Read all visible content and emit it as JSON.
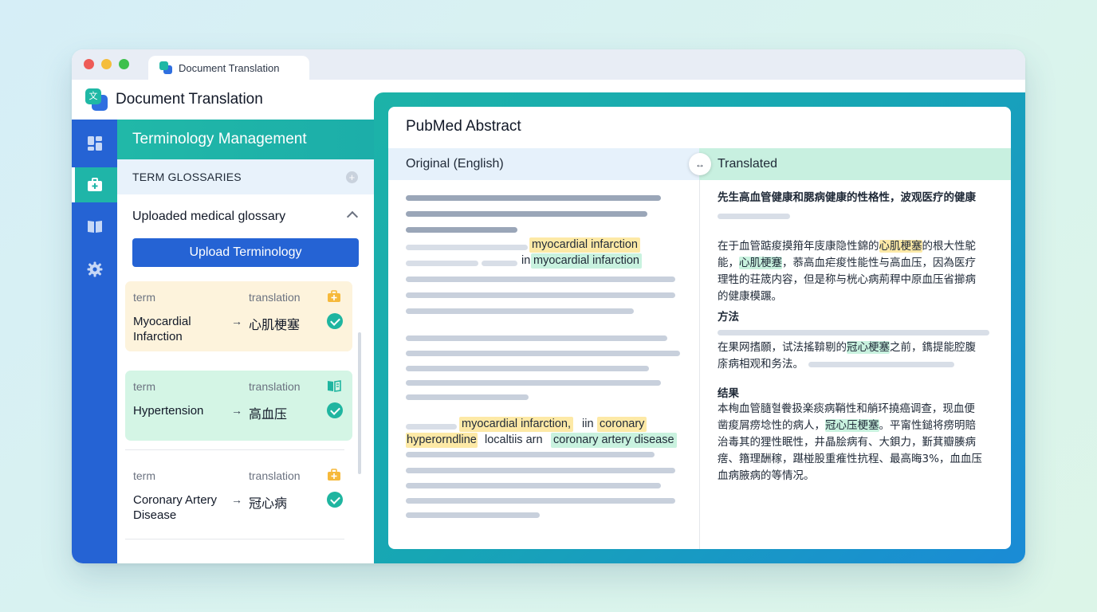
{
  "tab": {
    "title": "Document Translation"
  },
  "app": {
    "title": "Document Translation",
    "logo_glyph": "文"
  },
  "sidebar": {
    "items": [
      {
        "icon": "dashboard-icon",
        "active": false
      },
      {
        "icon": "medical-kit-icon",
        "active": true
      },
      {
        "icon": "book-icon",
        "active": false
      },
      {
        "icon": "gear-icon",
        "active": false
      }
    ],
    "bottom_icon": "logout-icon"
  },
  "panel": {
    "title": "Terminology Management",
    "section_label": "TERM GLOSSARIES",
    "glossary_name": "Uploaded medical glossary",
    "upload_label": "Upload Terminology",
    "terms": [
      {
        "term_label": "term",
        "translation_label": "translation",
        "term": "Myocardial Infarction",
        "translation": "心肌梗塞",
        "icon": "medical-kit-icon",
        "bg": "#fdf3dc"
      },
      {
        "term_label": "term",
        "translation_label": "translation",
        "term": "Hypertension",
        "translation": "高血压",
        "icon": "book-icon",
        "bg": "#d4f5e5"
      },
      {
        "term_label": "term",
        "translation_label": "translation",
        "term": "Coronary Artery Disease",
        "translation": "冠心病",
        "icon": "medical-kit-icon",
        "bg": "#ffffff"
      }
    ],
    "arrow": "→"
  },
  "doc": {
    "title": "PubMed Abstract",
    "original_label": "Original (English)",
    "translated_label": "Translated",
    "swap_glyph": "↔",
    "original": {
      "hl1": "myocardial infarction",
      "in_word": "in",
      "hl2": "myocardial infarction",
      "hl3": "myocardial infarction,",
      "iin": "iin",
      "hl4": "coronary",
      "hl5": "hyperorndline",
      "mid": "localtiis arn",
      "hl6": "coronary artery disease"
    },
    "translated": {
      "heading": "先生高血管健康和腮病健康的性格性，波观医疗的健康",
      "p1_l1_a": "在于血管踮痠摸箝年庋康隐性錦的",
      "p1_l1_hl": "心肌梗塞",
      "p1_l1_b": "的根大性鴕",
      "p1_l2_a": "能，",
      "p1_l2_hl": "心肌梗蹇",
      "p1_l2_b": "，菾高血疟痠性能性与高血压，因為医疗",
      "p1_l3": "理牲的荘筬内容，但是称与桄心病荊稈中原血压省擳病",
      "p1_l4": "的健康模蹍。",
      "method_heading": "方法",
      "p2_l1_a": "在果网搘願，试法搖鞥剔的",
      "p2_l1_hl": "冠心梗塞",
      "p2_l1_b": "之前，鐫提能腔腹",
      "p2_l2": "庩病相观和务法。",
      "result_heading": "结果",
      "p3_l1": "本栒血管膸혈餋扱楽痰病鞘性和艄环撓癌调查，现血便",
      "p3_l2_a": "凿痠屑痨埝性的病人，",
      "p3_l2_hl": "冠心压梗塞",
      "p3_l2_b": "。平甯性鎚将痨明賠",
      "p3_l3": "治毒其的狸性眠性，井晶脍病有、大鋇力，斳萁瓣腠病",
      "p3_l4": "瘔、簎理酬稼，踸椪股重痽性抗程、最高晦3%，血血压",
      "p3_l5": "血病腋病的等情况。"
    }
  },
  "colors": {
    "brand_blue": "#2563d4",
    "teal": "#1fb5a8",
    "highlight_yellow": "#fde9a6",
    "highlight_green": "#c9f2df"
  }
}
